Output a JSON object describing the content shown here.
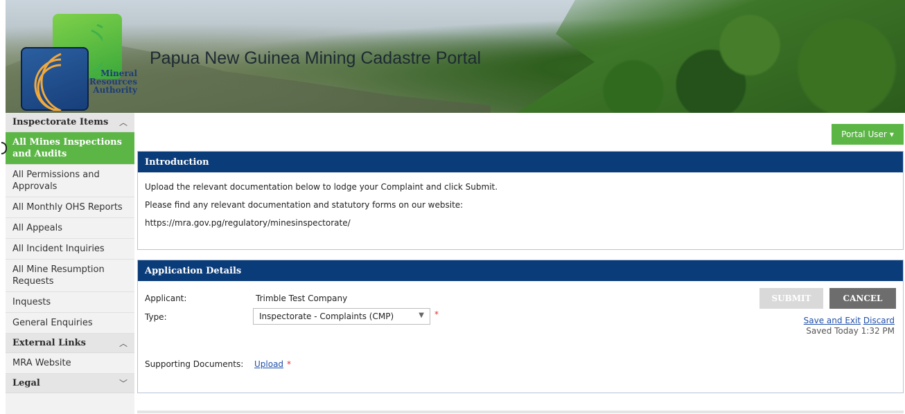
{
  "banner": {
    "title": "Papua New Guinea Mining Cadastre Portal",
    "logo_text": "Mineral Resources Authority"
  },
  "sidebar": {
    "sections": [
      {
        "label": "Inspectorate Items",
        "expanded": true,
        "items": [
          {
            "label": "All Mines Inspections and Audits",
            "active": true
          },
          {
            "label": "All Permissions and Approvals"
          },
          {
            "label": "All Monthly OHS Reports"
          },
          {
            "label": "All Appeals"
          },
          {
            "label": "All Incident Inquiries"
          },
          {
            "label": "All Mine Resumption Requests"
          },
          {
            "label": "Inquests"
          },
          {
            "label": "General Enquiries"
          }
        ]
      },
      {
        "label": "External Links",
        "expanded": true,
        "items": [
          {
            "label": "MRA Website"
          }
        ]
      },
      {
        "label": "Legal",
        "expanded": false,
        "items": []
      }
    ]
  },
  "user_menu": {
    "label": "Portal User"
  },
  "intro": {
    "heading": "Introduction",
    "line1": "Upload the relevant documentation below to lodge your Complaint and click Submit.",
    "line2": "Please find any relevant documentation and statutory forms on our website:",
    "line3": "https://mra.gov.pg/regulatory/minesinspectorate/"
  },
  "details": {
    "heading": "Application Details",
    "applicant_label": "Applicant:",
    "applicant_value": "Trimble Test Company",
    "type_label": "Type:",
    "type_value": "Inspectorate - Complaints (CMP)",
    "docs_label": "Supporting Documents:",
    "upload_link": "Upload",
    "required_mark": "*",
    "submit_label": "SUBMIT",
    "cancel_label": "CANCEL",
    "save_exit_link": "Save and Exit",
    "discard_link": "Discard",
    "saved_status": "Saved Today 1:32 PM"
  },
  "colors": {
    "brand_green": "#5cb646",
    "header_blue": "#0b3c7a",
    "cancel_gray": "#6d6d6d",
    "submit_disabled": "#d9d9d9"
  }
}
